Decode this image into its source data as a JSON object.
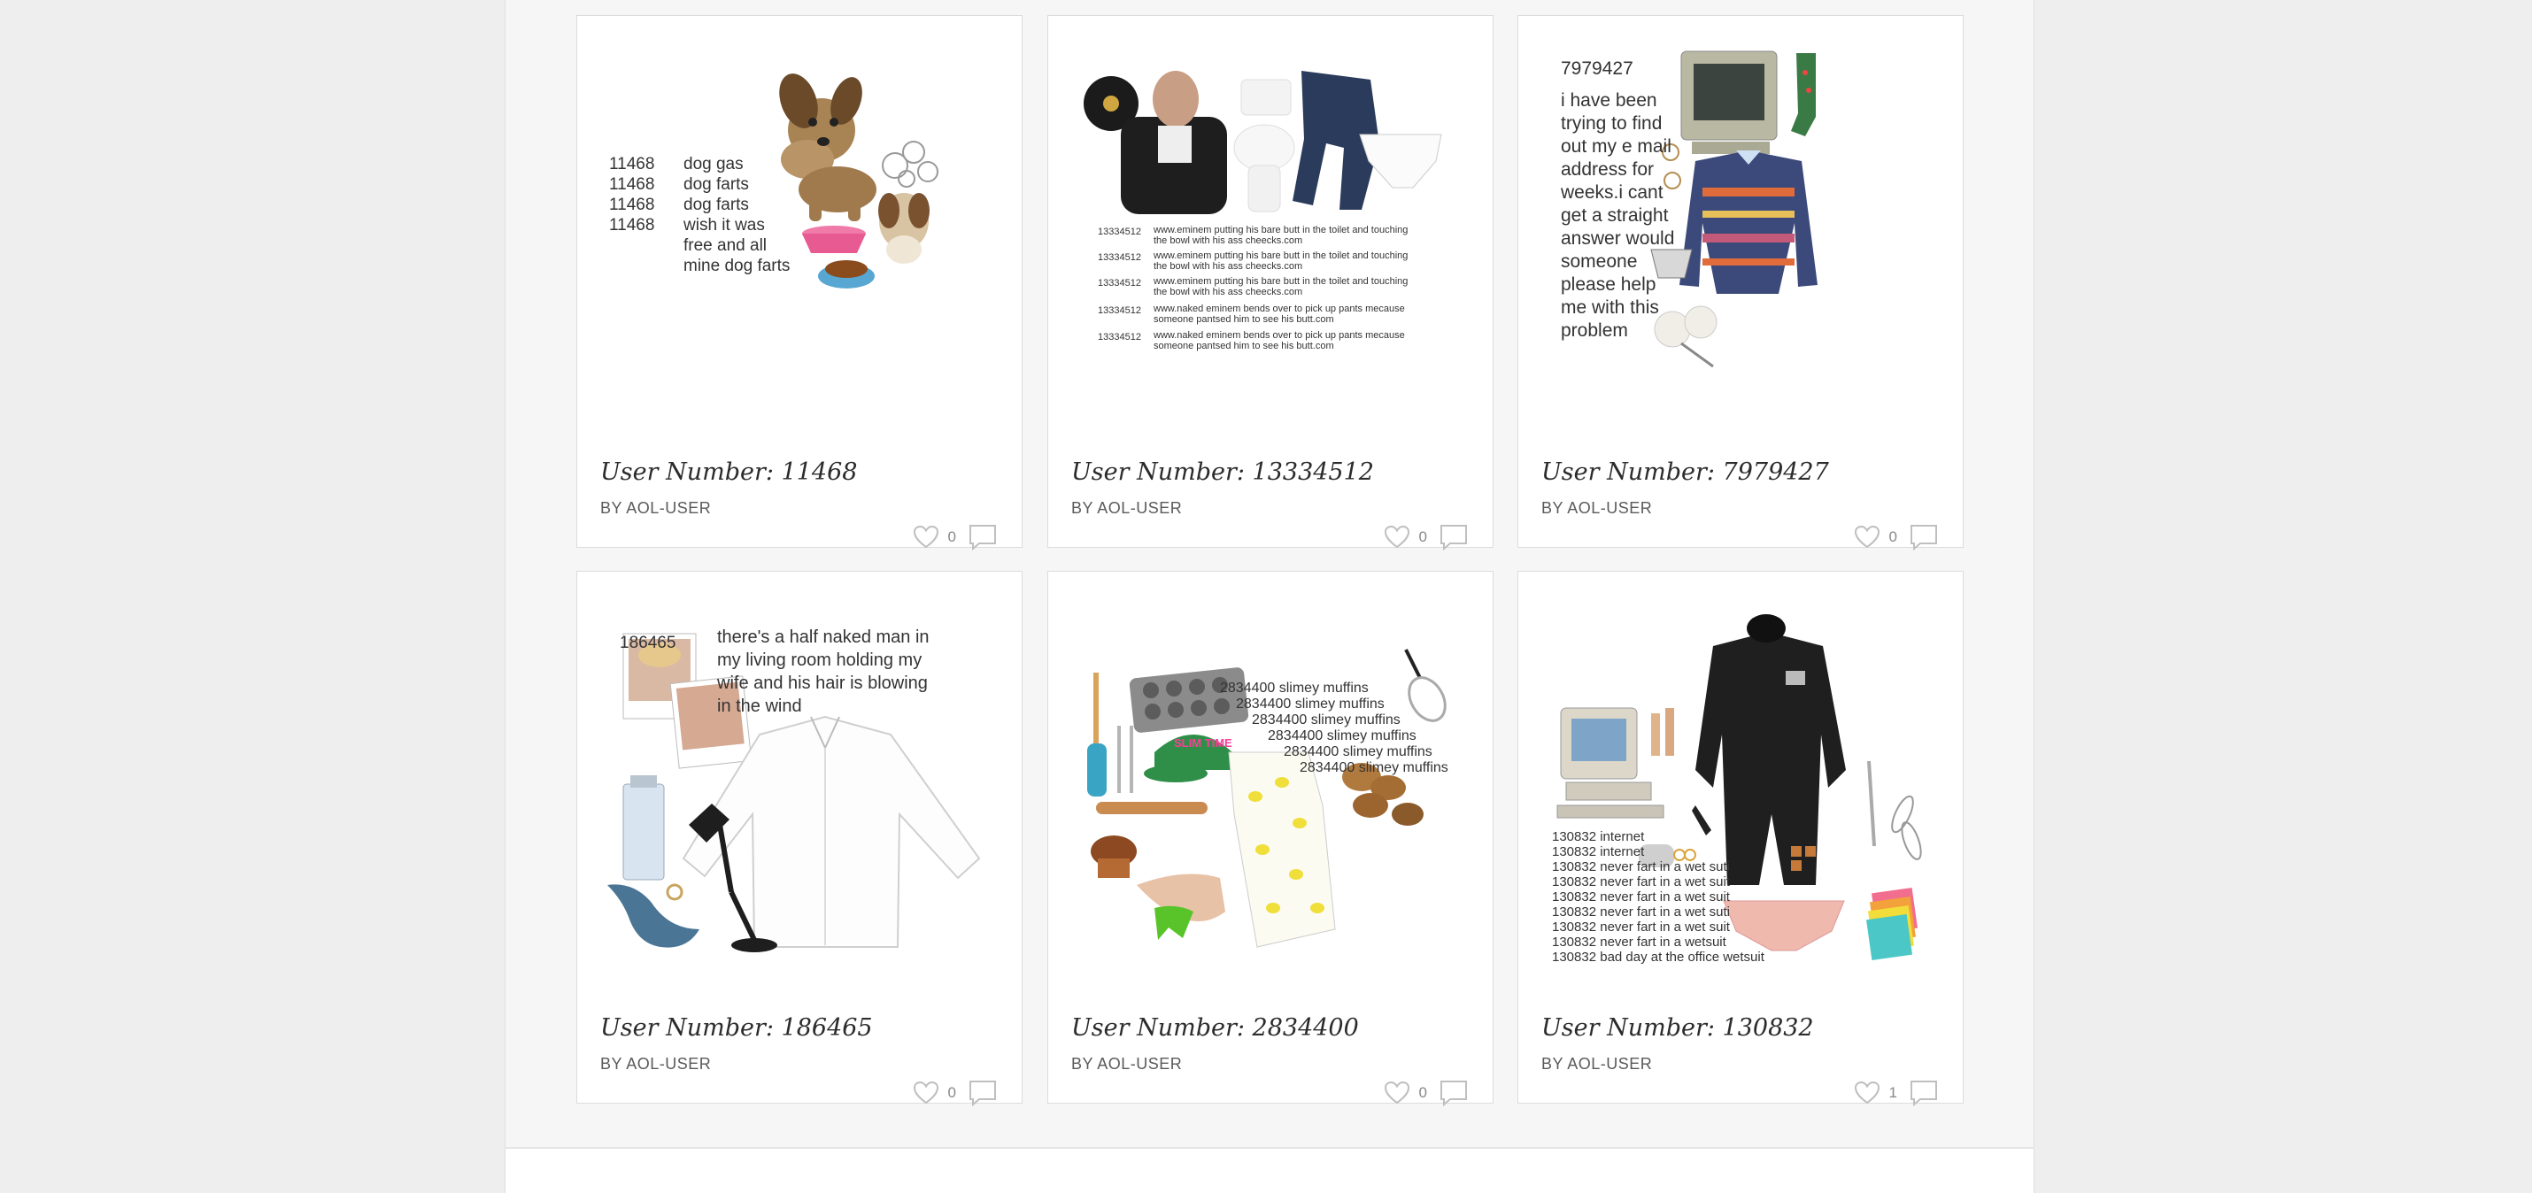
{
  "cards": [
    {
      "title": "User Number: 11468",
      "author": "BY AOL-USER",
      "likes": "0",
      "text_lines": [
        "11468",
        "11468",
        "11468",
        "11468",
        "dog gas",
        "dog farts",
        "dog farts",
        "wish it was",
        "free and all",
        "mine dog farts"
      ]
    },
    {
      "title": "User Number: 13334512",
      "author": "BY AOL-USER",
      "likes": "0",
      "text_lines": [
        "13334512",
        "www.eminem putting his bare butt in the toilet and touching",
        "the bowl with his ass cheecks.com",
        "13334512",
        "www.eminem putting his bare butt in the toilet and touching",
        "the bowl with his ass cheecks.com",
        "13334512",
        "www.eminem putting his bare butt in the toilet and touching",
        "the bowl with his ass cheecks.com",
        "13334512",
        "www.naked eminem bends over to pick up pants mecause",
        "someone pantsed him to see his butt.com",
        "13334512",
        "www.naked eminem bends over to pick up pants mecause",
        "someone pantsed him to see his butt.com"
      ]
    },
    {
      "title": "User Number: 7979427",
      "author": "BY AOL-USER",
      "likes": "0",
      "text_lines": [
        "7979427",
        "i have been",
        "trying to find",
        "out my e mail",
        "address for",
        "weeks.i cant",
        "get a straight",
        "answer would",
        "someone",
        "please help",
        "me with this",
        "problem"
      ]
    },
    {
      "title": "User Number: 186465",
      "author": "BY AOL-USER",
      "likes": "0",
      "text_lines": [
        "186465",
        "there's a half naked man in",
        "my living room holding my",
        "wife and his hair is blowing",
        "in the wind"
      ]
    },
    {
      "title": "User Number: 2834400",
      "author": "BY AOL-USER",
      "likes": "0",
      "text_lines": [
        "2834400 slimey muffins",
        "2834400 slimey muffins",
        "2834400 slimey muffins",
        "2834400 slimey muffins",
        "2834400 slimey muffins",
        "2834400 slimey muffins",
        "SLIM TIME"
      ]
    },
    {
      "title": "User Number: 130832",
      "author": "BY AOL-USER",
      "likes": "1",
      "text_lines": [
        "130832 internet",
        "130832 internet",
        "130832 never fart in a wet suti",
        "130832 never fart in a wet suit",
        "130832 never fart in a wet suit",
        "130832 never fart in a wet suti",
        "130832 never fart in a wet suit",
        "130832 never fart in a wetsuit",
        "130832 bad day at the office wetsuit"
      ]
    }
  ],
  "colors": {
    "page_bg": "#eeeeef",
    "column_bg": "#f6f6f7",
    "card_bg": "#ffffff",
    "border": "#dcdcdc"
  },
  "icons": {
    "like": "heart-icon",
    "comment": "comment-icon"
  }
}
